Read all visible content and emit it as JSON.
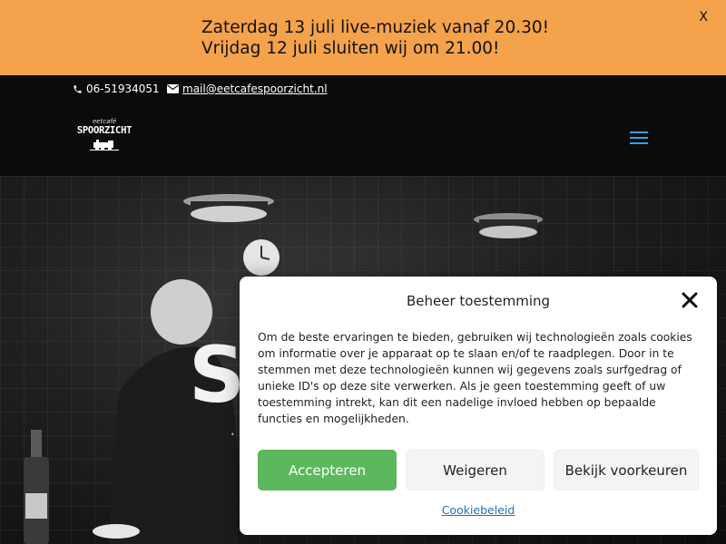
{
  "announcement": {
    "line1": "Zaterdag 13 juli live-muziek vanaf 20.30!",
    "line2": "Vrijdag 12 juli sluiten wij om 21.00!",
    "close_label": "X"
  },
  "topbar": {
    "phone": "06-51934051",
    "email": "mail@eetcafespoorzicht.nl",
    "phone_icon": "phone-icon",
    "email_icon": "envelope-icon"
  },
  "header": {
    "logo_small": "eetcafé",
    "logo_main": "SPOORZICHT",
    "menu_icon": "hamburger-icon",
    "menu_color": "#2ea3f2"
  },
  "hero": {
    "title": "SP"
  },
  "cookie_modal": {
    "title": "Beheer toestemming",
    "body": "Om de beste ervaringen te bieden, gebruiken wij technologieën zoals cookies om informatie over je apparaat op te slaan en/of te raadplegen. Door in te stemmen met deze technologieën kunnen wij gegevens zoals surfgedrag of unieke ID's op deze site verwerken. Als je geen toestemming geeft of uw toestemming intrekt, kan dit een nadelige invloed hebben op bepaalde functies en mogelijkheden.",
    "accept_label": "Accepteren",
    "deny_label": "Weigeren",
    "prefs_label": "Bekijk voorkeuren",
    "policy_link": "Cookiebeleid",
    "accept_color": "#5cb85c",
    "link_color": "#1e73be"
  },
  "colors": {
    "announcement_bg": "#f4a24b",
    "page_bg": "#0b0b0b"
  }
}
